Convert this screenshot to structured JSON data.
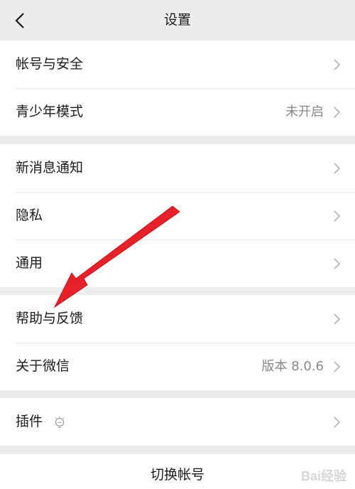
{
  "header": {
    "title": "设置",
    "back_icon": "chevron-left-icon"
  },
  "groups": [
    {
      "rows": [
        {
          "label": "帐号与安全",
          "value": ""
        },
        {
          "label": "青少年模式",
          "value": "未开启"
        }
      ]
    },
    {
      "rows": [
        {
          "label": "新消息通知",
          "value": ""
        },
        {
          "label": "隐私",
          "value": ""
        },
        {
          "label": "通用",
          "value": ""
        }
      ]
    },
    {
      "rows": [
        {
          "label": "帮助与反馈",
          "value": ""
        },
        {
          "label": "关于微信",
          "value": "版本 8.0.6"
        }
      ]
    },
    {
      "rows": [
        {
          "label": "插件",
          "value": "",
          "icon": "lightbulb-icon"
        }
      ]
    }
  ],
  "switch_account": {
    "label": "切换帐号"
  },
  "annotation": {
    "color": "#e8202a",
    "points_to": "帮助与反馈"
  },
  "watermark": {
    "text": "Bai经验"
  },
  "colors": {
    "background": "#ededed",
    "card": "#ffffff",
    "secondary_text": "#888888"
  }
}
